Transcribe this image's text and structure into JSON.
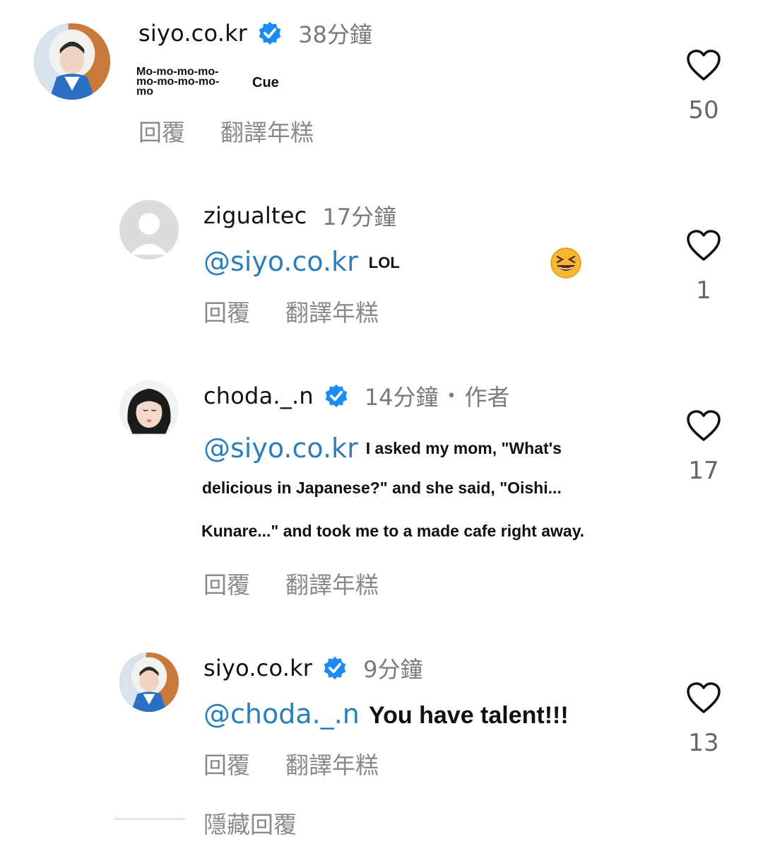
{
  "comments": [
    {
      "username": "siyo.co.kr",
      "verified": true,
      "time": "38分鐘",
      "text_lines": [
        "Mo-mo-mo-mo-",
        "mo-mo-mo-mo-",
        "mo"
      ],
      "text_extra": "Cue",
      "reply_label": "回覆",
      "translate_label": "翻譯年糕",
      "likes": "50"
    },
    {
      "username": "zigualtec",
      "verified": false,
      "time": "17分鐘",
      "mention": "@siyo.co.kr",
      "text": "LOL",
      "emoji": "laughing-face-emoji",
      "reply_label": "回覆",
      "translate_label": "翻譯年糕",
      "likes": "1"
    },
    {
      "username": "choda._.n",
      "verified": true,
      "time": "14分鐘",
      "author_dot": "•",
      "author_label": "作者",
      "mention": "@siyo.co.kr",
      "text_line1": "I asked my mom, \"What's",
      "text_line2": "delicious in Japanese?\" and she said, \"Oishi...",
      "text_line3": "Kunare...\" and took me to a made cafe right away.",
      "reply_label": "回覆",
      "translate_label": "翻譯年糕",
      "likes": "17"
    },
    {
      "username": "siyo.co.kr",
      "verified": true,
      "time": "9分鐘",
      "mention": "@choda._.n",
      "text": "You have talent!!!",
      "reply_label": "回覆",
      "translate_label": "翻譯年糕",
      "likes": "13"
    }
  ],
  "hide_replies_label": "隱藏回覆",
  "colors": {
    "mention": "#2a7fb8",
    "verified": "#1d8cf0",
    "muted": "#7a7a7a"
  },
  "icons": [
    "verified-badge-icon",
    "heart-icon",
    "laughing-face-emoji"
  ]
}
